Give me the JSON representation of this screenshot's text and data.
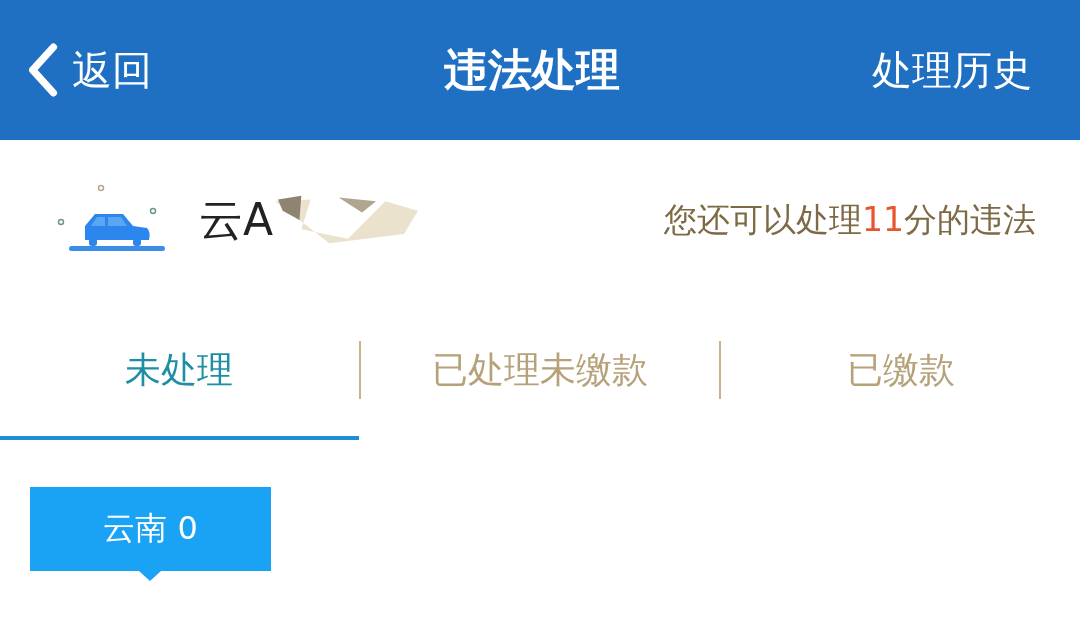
{
  "header": {
    "back": "返回",
    "title": "违法处理",
    "action": "处理历史"
  },
  "vehicle": {
    "plate": "云A",
    "quota": "您还可以处理**11**分的违法"
  },
  "tabs": [
    {
      "label": "未处理",
      "selected": true
    },
    {
      "label": "已处理未缴款",
      "selected": false
    },
    {
      "label": "已缴款",
      "selected": false
    }
  ],
  "region_chip": {
    "label": "云南 0",
    "selected": true
  }
}
